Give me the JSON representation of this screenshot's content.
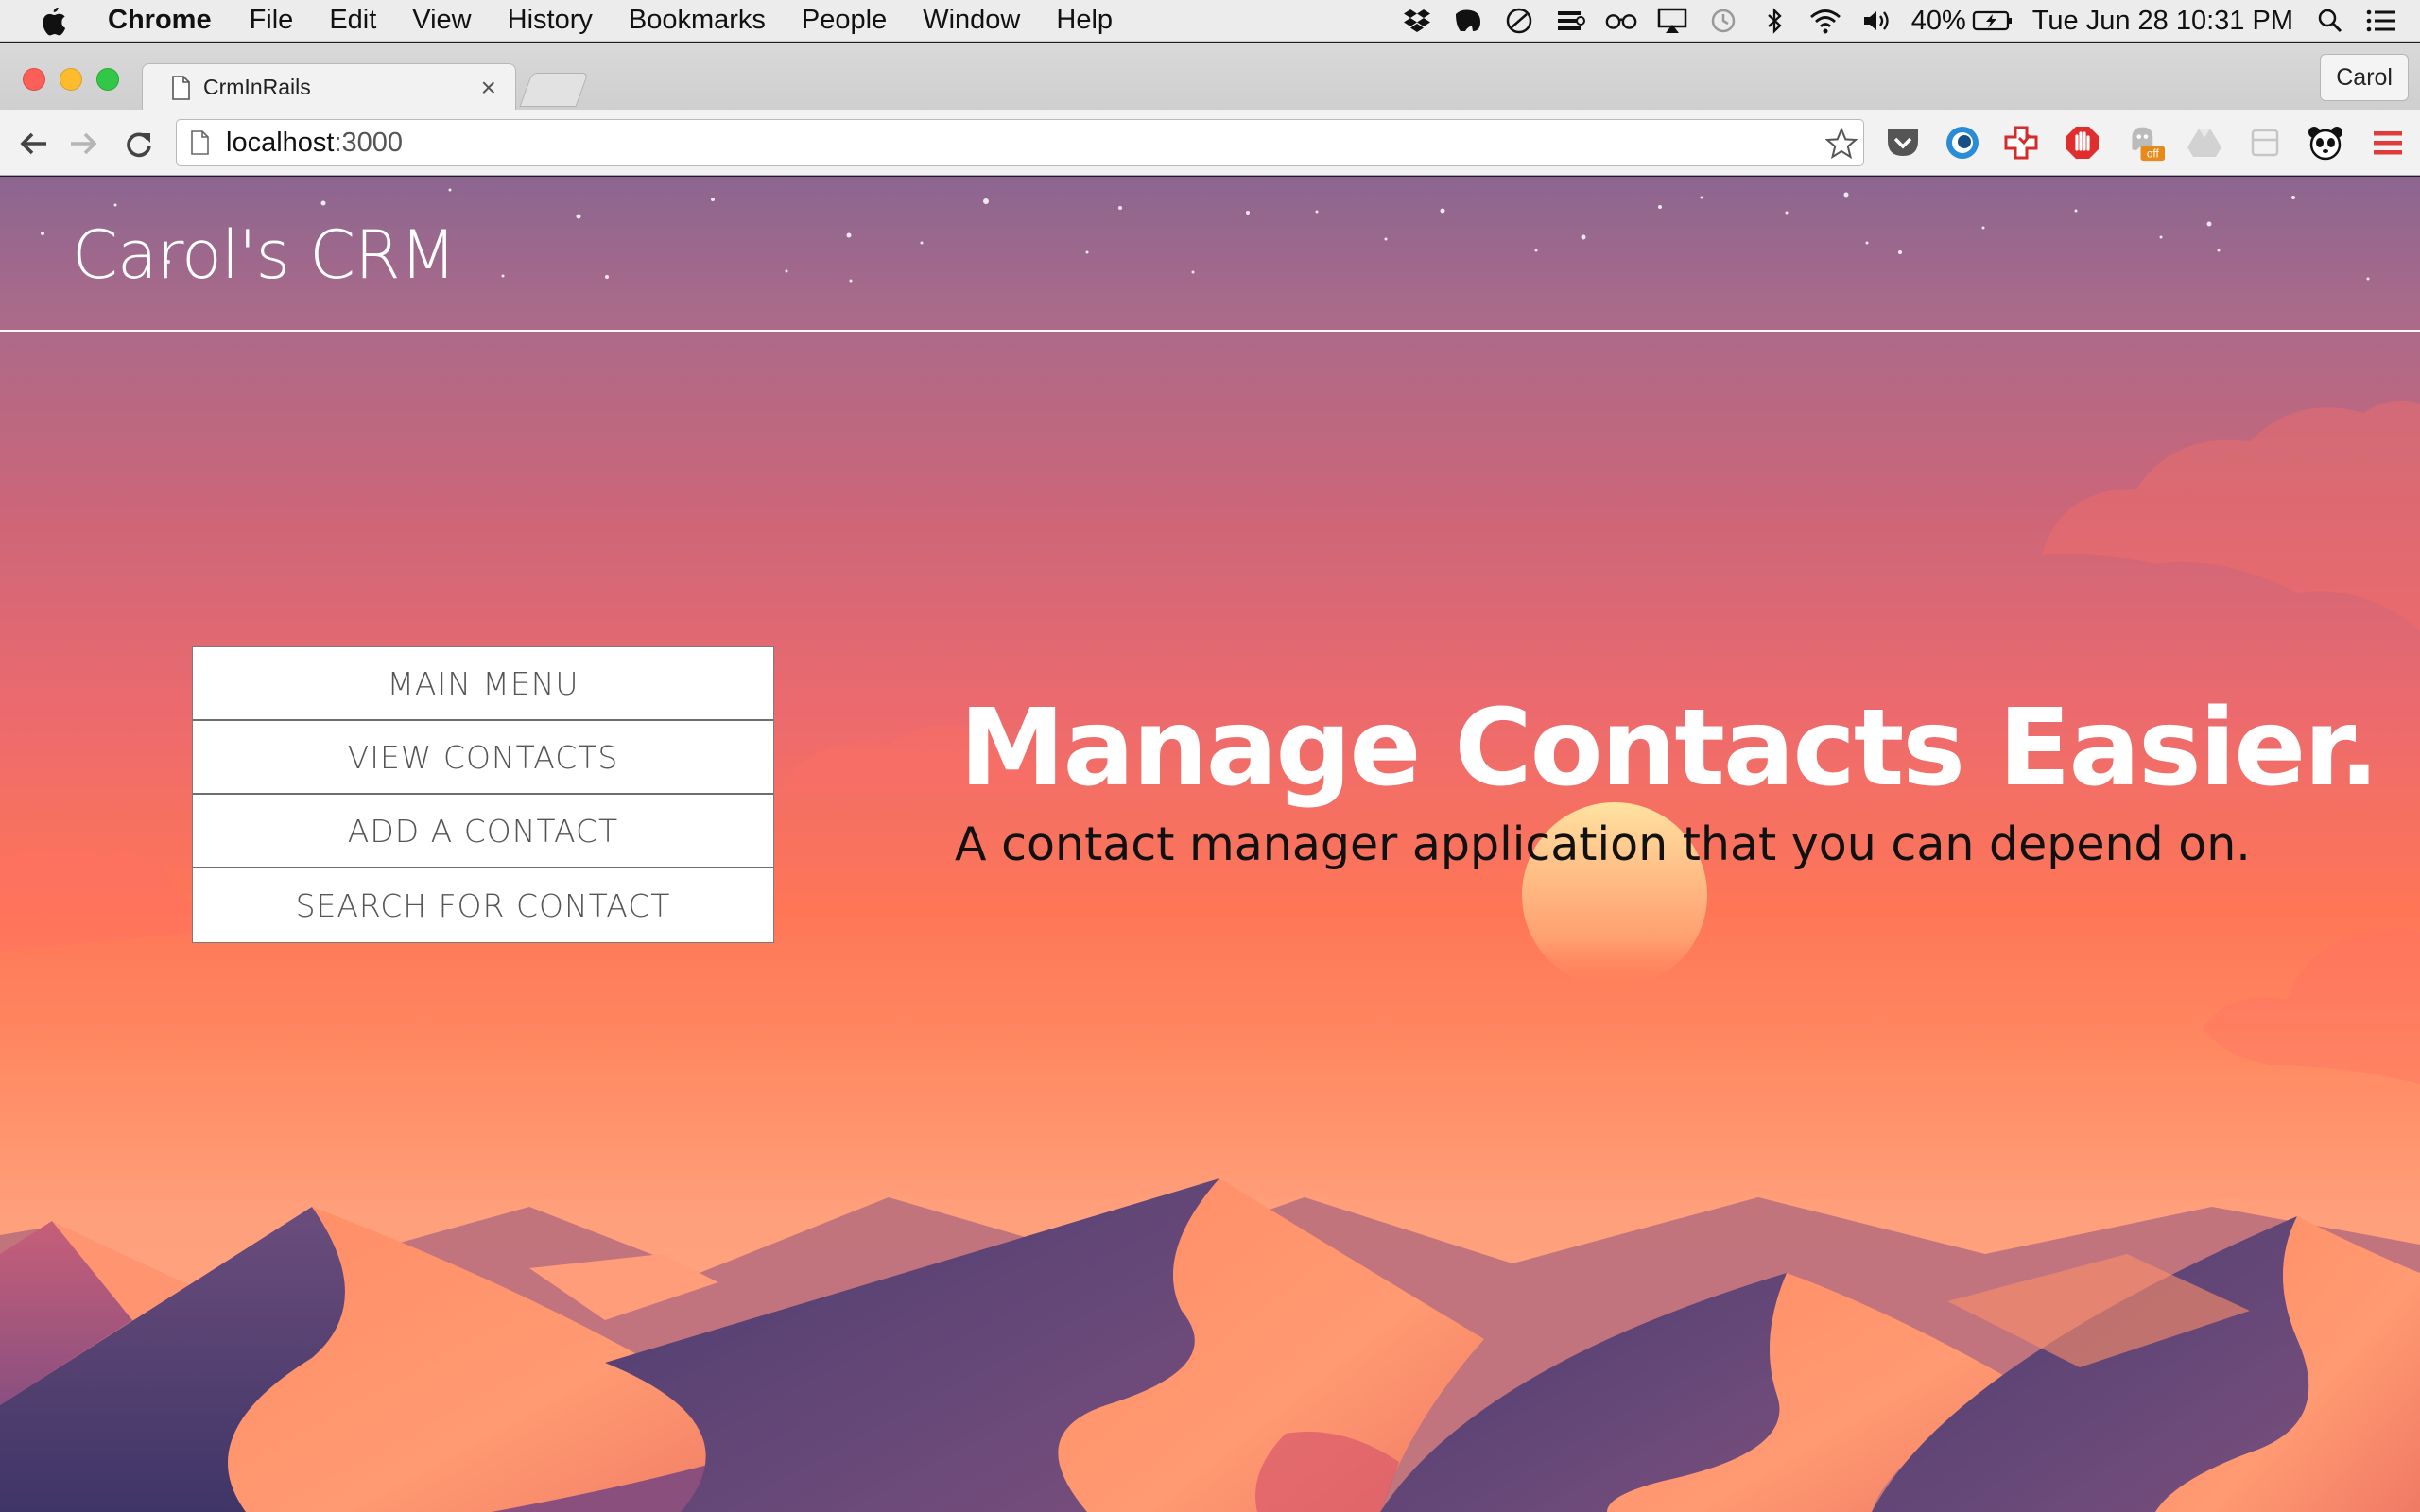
{
  "menubar": {
    "items": [
      "Chrome",
      "File",
      "Edit",
      "View",
      "History",
      "Bookmarks",
      "People",
      "Window",
      "Help"
    ],
    "battery": "40%",
    "clock": "Tue Jun 28  10:31 PM",
    "icons": [
      "dropbox-icon",
      "evernote-icon",
      "do-not-disturb-icon",
      "cast-icon",
      "glasses-icon",
      "airplay-icon",
      "time-machine-icon",
      "bluetooth-icon",
      "wifi-icon",
      "volume-icon",
      "battery-icon",
      "spotlight-icon",
      "notification-center-icon"
    ]
  },
  "browser": {
    "tab_title": "CrmInRails",
    "profile": "Carol",
    "url_host": "localhost",
    "url_port": ":3000",
    "extensions": [
      "pocket-icon",
      "lastpass-icon",
      "health-extension-icon",
      "adblock-icon",
      "ghostery-icon",
      "drive-icon",
      "extension-icon",
      "panda-icon",
      "menu-icon"
    ],
    "ghostery_badge": "off"
  },
  "site": {
    "brand": "Carol's CRM",
    "nav": [
      "MAIN MENU",
      "VIEW CONTACTS",
      "ADD A CONTACT",
      "SEARCH FOR CONTACT"
    ],
    "hero_title": "Manage Contacts Easier.",
    "hero_subtitle": "A contact manager application that you can depend on."
  },
  "colors": {
    "sky_top": "#8c6690",
    "sky_mid": "#ff7656",
    "sky_low": "#ffa683",
    "dune_purple": "#4d3f73",
    "dune_orange": "#ff8c64"
  }
}
